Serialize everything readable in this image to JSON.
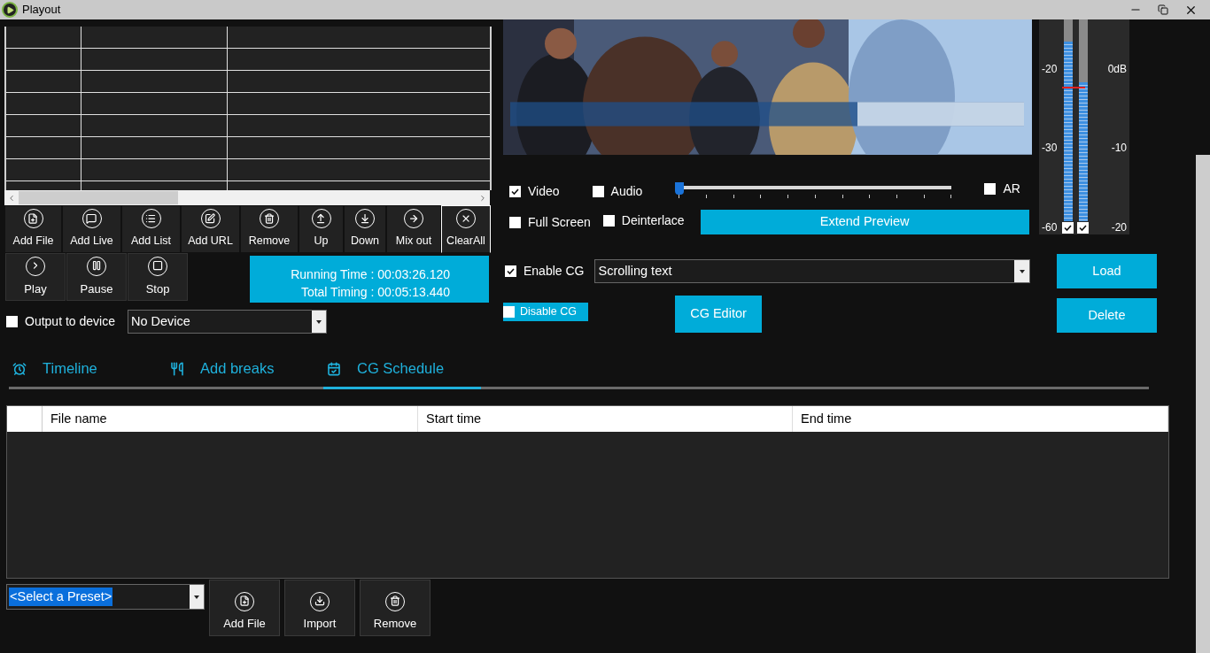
{
  "window": {
    "title": "Playout"
  },
  "toolbar": [
    {
      "label": "Add File",
      "selected": false
    },
    {
      "label": "Add Live",
      "selected": false
    },
    {
      "label": "Add List",
      "selected": false
    },
    {
      "label": "Add URL",
      "selected": false
    },
    {
      "label": "Remove",
      "selected": false
    },
    {
      "label": "Up",
      "selected": false
    },
    {
      "label": "Down",
      "selected": false
    },
    {
      "label": "Mix out",
      "selected": false
    },
    {
      "label": "ClearAll",
      "selected": true
    }
  ],
  "transport": [
    {
      "label": "Play"
    },
    {
      "label": "Pause"
    },
    {
      "label": "Stop"
    }
  ],
  "timing": {
    "running": "Running Time : 00:03:26.120",
    "total": "Total Timing : 00:05:13.440"
  },
  "output": {
    "label": "Output to device",
    "checked": false,
    "device": "No Device"
  },
  "preview_options": {
    "video": {
      "label": "Video",
      "checked": true
    },
    "audio": {
      "label": "Audio",
      "checked": false
    },
    "volume": {
      "level": 0
    },
    "ar": {
      "label": "AR",
      "checked": false
    },
    "full_screen": {
      "label": "Full Screen",
      "checked": false
    },
    "deinterlace": {
      "label": "Deinterlace",
      "checked": false
    },
    "extend_button": "Extend Preview"
  },
  "meter": {
    "left_labels": [
      "-20",
      "-30",
      "-60"
    ],
    "right_labels": [
      "0dB",
      "-10",
      "-20"
    ],
    "channels": [
      {
        "level": 0.89,
        "checked": true
      },
      {
        "level": 0.69,
        "checked": true
      }
    ]
  },
  "cg": {
    "enable": {
      "label": "Enable CG",
      "checked": true
    },
    "template": "Scrolling text",
    "disable": {
      "label": "Disable CG",
      "checked": false
    },
    "editor_button": "CG Editor",
    "load_button": "Load",
    "delete_button": "Delete"
  },
  "tabs": [
    {
      "label": "Timeline",
      "selected": false
    },
    {
      "label": "Add breaks",
      "selected": false
    },
    {
      "label": "CG Schedule",
      "selected": true
    }
  ],
  "schedule": {
    "columns": [
      "File name",
      "Start time",
      "End time"
    ]
  },
  "preset": {
    "value": "<Select a Preset>"
  },
  "schedule_buttons": [
    {
      "label": "Add File"
    },
    {
      "label": "Import"
    },
    {
      "label": "Remove"
    }
  ]
}
